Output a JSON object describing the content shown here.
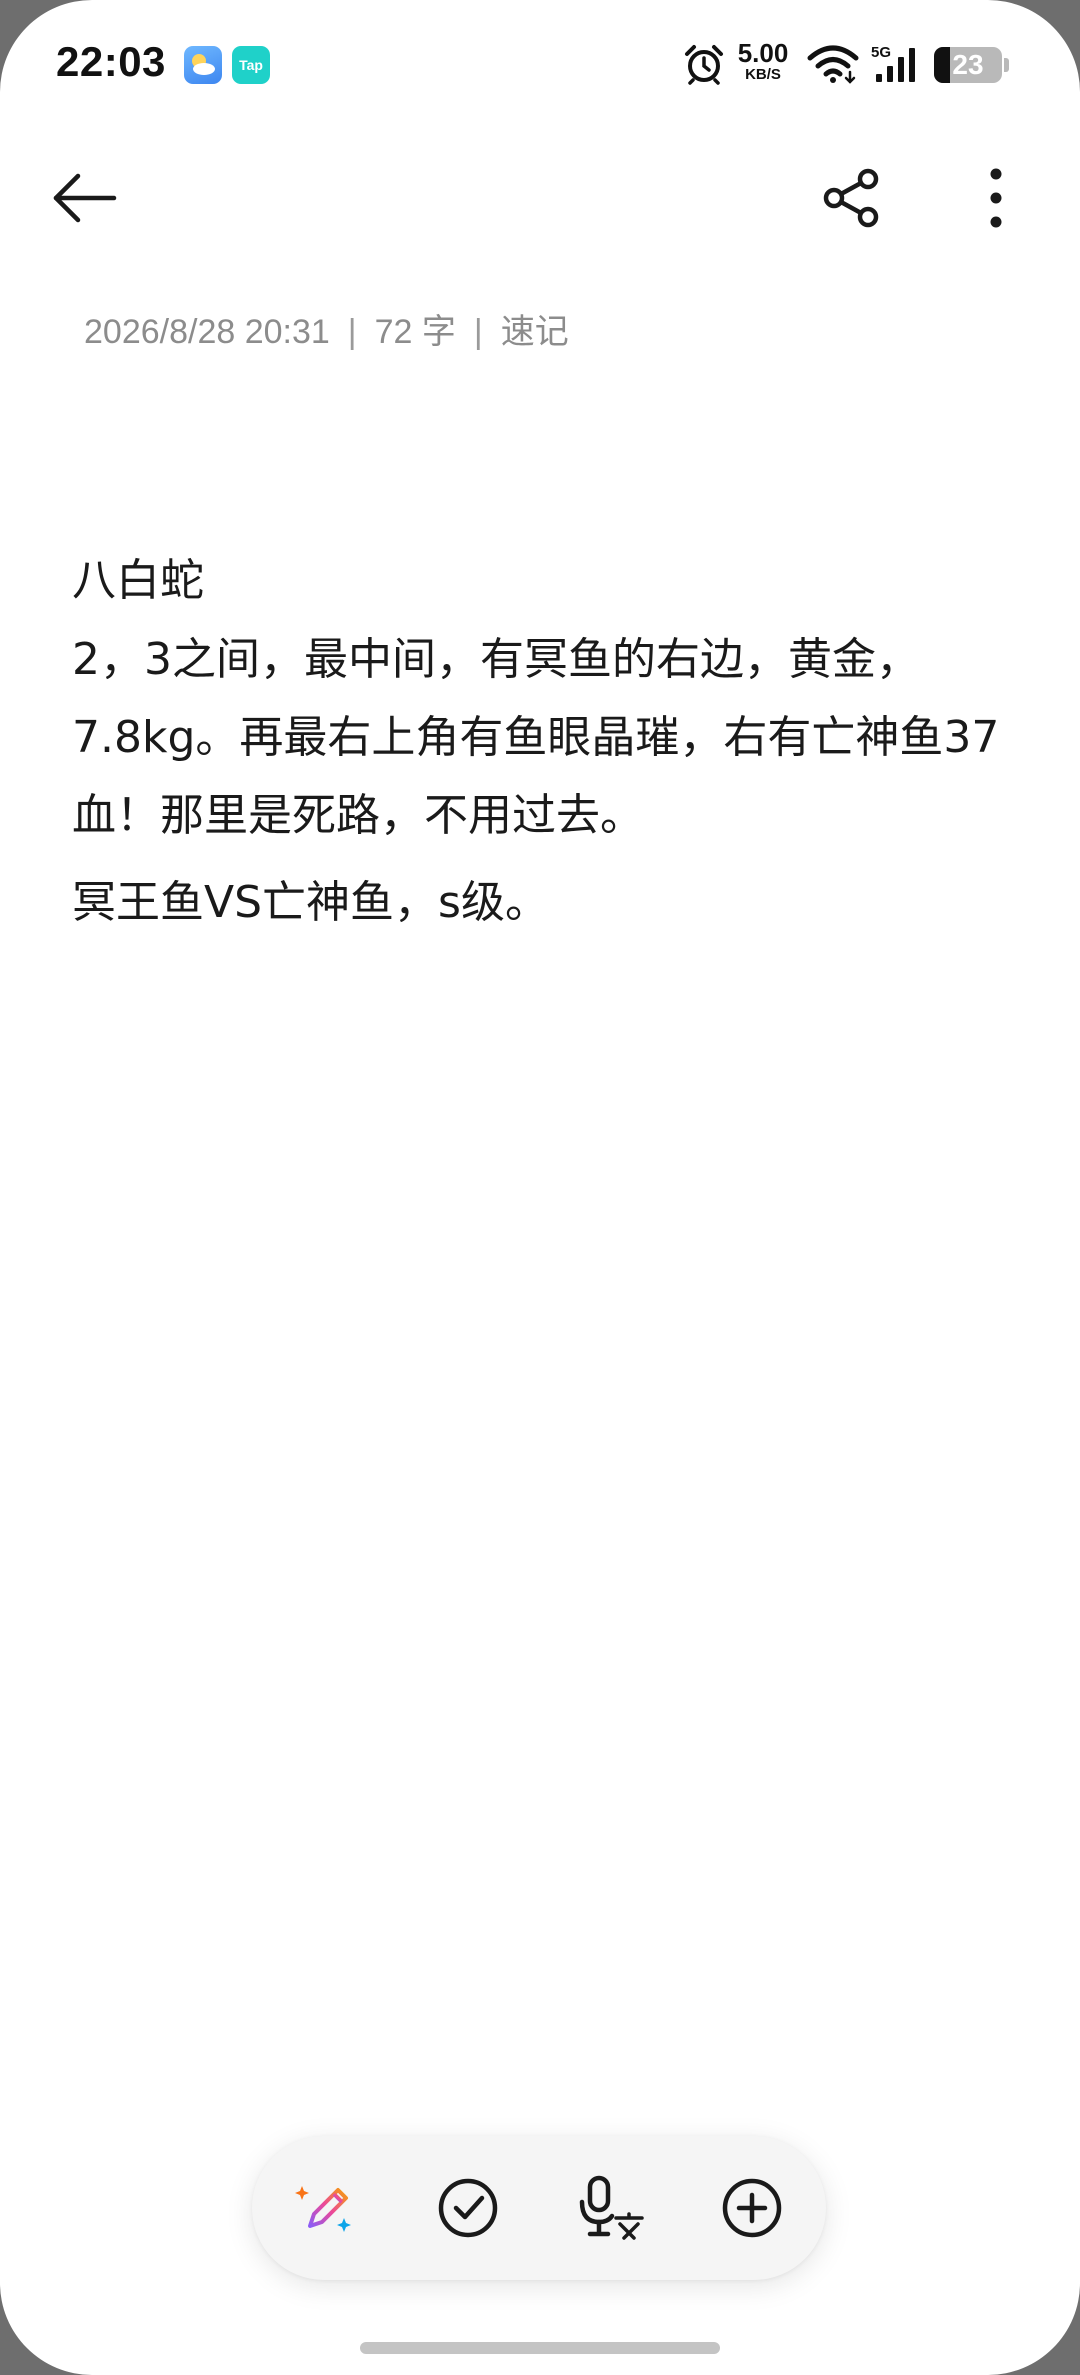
{
  "status_bar": {
    "time": "22:03",
    "app_tap_label": "Tap",
    "net_speed_value": "5.00",
    "net_speed_unit": "KB/S",
    "network_type": "5G",
    "battery_level": "23"
  },
  "note": {
    "meta_datetime": "2026/8/28 20:31",
    "meta_word_count": "72 字",
    "meta_category": "速记",
    "meta_separator": "|",
    "title": "八白蛇",
    "paragraph_1": "2，3之间，最中间，有冥鱼的右边，黄金，7.8kg。再最右上角有鱼眼晶璀，右有亡神鱼37血！那里是死路，不用过去。",
    "paragraph_2": "冥王鱼VS亡神鱼，s级。"
  },
  "icons": {
    "back": "arrow-left-icon",
    "share": "share-icon",
    "more": "more-vertical-icon",
    "ai_write": "ai-pen-icon",
    "checklist": "check-circle-icon",
    "voice": "mic-translate-icon",
    "add": "plus-circle-icon"
  },
  "colors": {
    "background": "#ffffff",
    "text": "#1a1a1a",
    "meta_text": "#8c8c8c",
    "toolbar_bg": "#f5f5f5"
  }
}
